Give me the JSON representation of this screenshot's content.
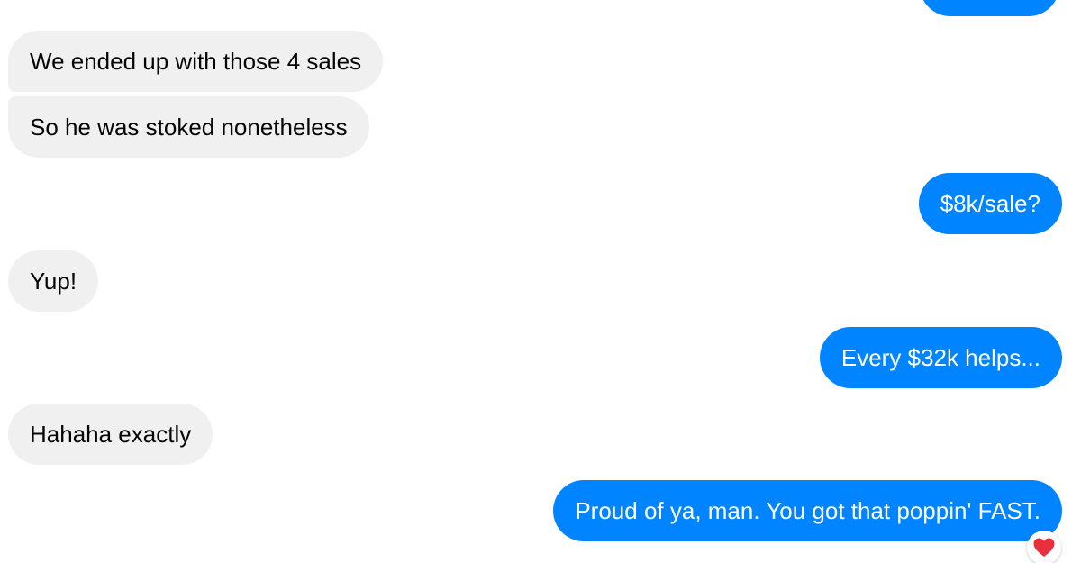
{
  "messages": [
    {
      "direction": "incoming",
      "text": "We ended up with those 4 sales"
    },
    {
      "direction": "incoming",
      "text": "So he was stoked nonetheless"
    },
    {
      "direction": "outgoing",
      "text": "$8k/sale?"
    },
    {
      "direction": "incoming",
      "text": "Yup!"
    },
    {
      "direction": "outgoing",
      "text": "Every $32k helps..."
    },
    {
      "direction": "incoming",
      "text": "Hahaha exactly"
    },
    {
      "direction": "outgoing",
      "text": "Proud of ya, man. You got that poppin' FAST."
    }
  ],
  "reaction": {
    "icon": "heart-icon",
    "color": "#e8303d"
  },
  "colors": {
    "outgoing_bubble": "#0084ff",
    "incoming_bubble": "#f0f0f0",
    "incoming_text": "#050505",
    "outgoing_text": "#ffffff"
  }
}
